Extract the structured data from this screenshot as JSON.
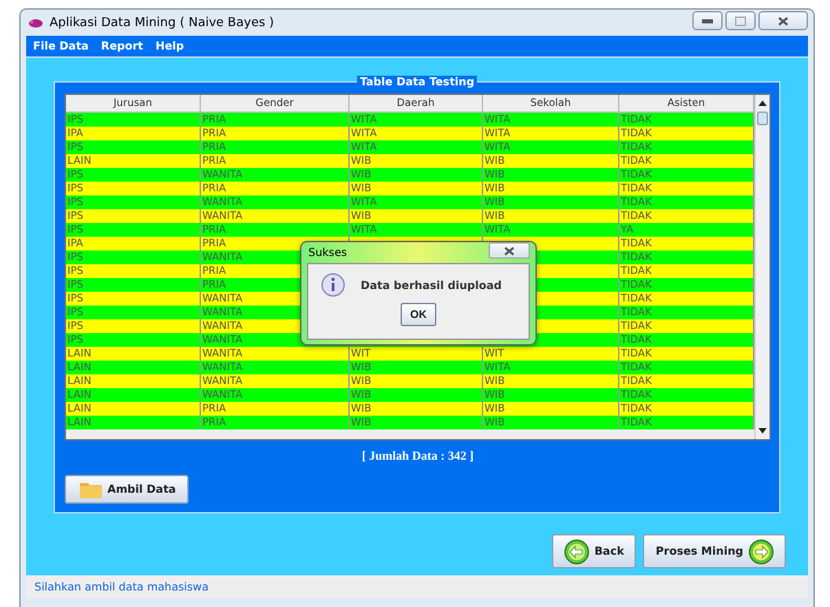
{
  "window": {
    "title": "Aplikasi Data Mining ( Naive Bayes )"
  },
  "menu": [
    "File Data",
    "Report",
    "Help"
  ],
  "panel": {
    "title": "Table Data Testing",
    "table": {
      "columns": [
        "Jurusan",
        "Gender",
        "Daerah",
        "Sekolah",
        "Asisten"
      ],
      "rows": [
        {
          "color": "#00ff00",
          "cells": [
            "IPS",
            "PRIA",
            "WITA",
            "WITA",
            "TIDAK"
          ]
        },
        {
          "color": "#ffff00",
          "cells": [
            "IPA",
            "PRIA",
            "WITA",
            "WITA",
            "TIDAK"
          ]
        },
        {
          "color": "#00ff00",
          "cells": [
            "IPS",
            "PRIA",
            "WITA",
            "WITA",
            "TIDAK"
          ]
        },
        {
          "color": "#ffff00",
          "cells": [
            "LAIN",
            "PRIA",
            "WIB",
            "WIB",
            "TIDAK"
          ]
        },
        {
          "color": "#00ff00",
          "cells": [
            "IPS",
            "WANITA",
            "WIB",
            "WIB",
            "TIDAK"
          ]
        },
        {
          "color": "#ffff00",
          "cells": [
            "IPS",
            "PRIA",
            "WIB",
            "WIB",
            "TIDAK"
          ]
        },
        {
          "color": "#00ff00",
          "cells": [
            "IPS",
            "WANITA",
            "WITA",
            "WIB",
            "TIDAK"
          ]
        },
        {
          "color": "#ffff00",
          "cells": [
            "IPS",
            "WANITA",
            "WIB",
            "WIB",
            "TIDAK"
          ]
        },
        {
          "color": "#00ff00",
          "cells": [
            "IPS",
            "PRIA",
            "WITA",
            "WITA",
            "YA"
          ]
        },
        {
          "color": "#ffff00",
          "cells": [
            "IPA",
            "PRIA",
            null,
            null,
            "TIDAK"
          ]
        },
        {
          "color": "#00ff00",
          "cells": [
            "IPS",
            "WANITA",
            null,
            null,
            "TIDAK"
          ]
        },
        {
          "color": "#ffff00",
          "cells": [
            "IPS",
            "PRIA",
            null,
            null,
            "TIDAK"
          ]
        },
        {
          "color": "#00ff00",
          "cells": [
            "IPS",
            "PRIA",
            null,
            null,
            "TIDAK"
          ]
        },
        {
          "color": "#ffff00",
          "cells": [
            "IPS",
            "WANITA",
            null,
            null,
            "TIDAK"
          ]
        },
        {
          "color": "#00ff00",
          "cells": [
            "IPS",
            "WANITA",
            null,
            null,
            "TIDAK"
          ]
        },
        {
          "color": "#ffff00",
          "cells": [
            "IPS",
            "WANITA",
            null,
            null,
            "TIDAK"
          ]
        },
        {
          "color": "#00ff00",
          "cells": [
            "IPS",
            "WANITA",
            null,
            null,
            "TIDAK"
          ]
        },
        {
          "color": "#ffff00",
          "cells": [
            "LAIN",
            "WANITA",
            "WIT",
            "WIT",
            "TIDAK"
          ]
        },
        {
          "color": "#00ff00",
          "cells": [
            "LAIN",
            "WANITA",
            "WIB",
            "WITA",
            "TIDAK"
          ]
        },
        {
          "color": "#ffff00",
          "cells": [
            "LAIN",
            "WANITA",
            "WIB",
            "WIB",
            "TIDAK"
          ]
        },
        {
          "color": "#00ff00",
          "cells": [
            "LAIN",
            "WANITA",
            "WIB",
            "WIB",
            "TIDAK"
          ]
        },
        {
          "color": "#ffff00",
          "cells": [
            "LAIN",
            "PRIA",
            "WIB",
            "WIB",
            "TIDAK"
          ]
        },
        {
          "color": "#00ff00",
          "cells": [
            "LAIN",
            "PRIA",
            "WIB",
            "WIB",
            "TIDAK"
          ]
        }
      ]
    },
    "count": "[ Jumlah Data : 342 ]",
    "load_button": "Ambil Data"
  },
  "back_button": "Back",
  "process_button": "Proses Mining",
  "status_bar": "Silahkan ambil data mahasiswa",
  "dialog": {
    "title": "Sukses",
    "message": "Data berhasil diupload",
    "button": "OK"
  }
}
